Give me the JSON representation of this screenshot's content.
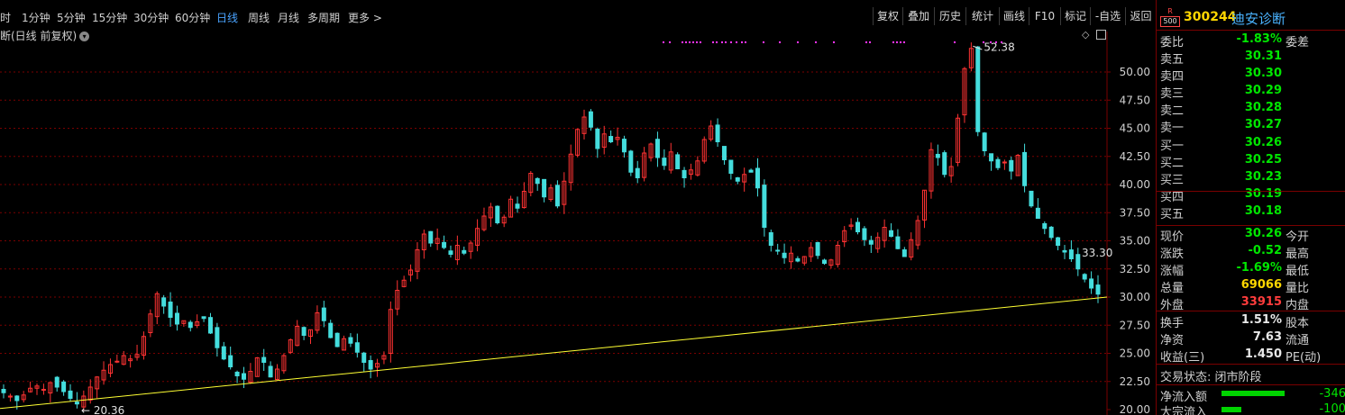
{
  "toolbar": {
    "periods": [
      "时",
      "1分钟",
      "5分钟",
      "15分钟",
      "30分钟",
      "60分钟",
      "日线",
      "周线",
      "月线",
      "多周期",
      "更多 >"
    ],
    "active_period": "日线",
    "buttons": [
      "复权",
      "叠加",
      "历史",
      "统计",
      "画线",
      "F10",
      "标记",
      "-自选",
      "返回"
    ]
  },
  "chart_title": "断(日线 前复权)",
  "stock": {
    "badge_top": "R",
    "badge_bottom": "500",
    "code": "300244",
    "name": "迪安诊断"
  },
  "quote_rows": [
    {
      "label": "委比",
      "value": "-1.83%",
      "label2": "委差",
      "color": "green"
    },
    {
      "label": "卖五",
      "value": "30.31",
      "label2": "",
      "color": "green"
    },
    {
      "label": "卖四",
      "value": "30.30",
      "label2": "",
      "color": "green"
    },
    {
      "label": "卖三",
      "value": "30.29",
      "label2": "",
      "color": "green"
    },
    {
      "label": "卖二",
      "value": "30.28",
      "label2": "",
      "color": "green"
    },
    {
      "label": "卖一",
      "value": "30.27",
      "label2": "",
      "color": "green"
    },
    {
      "label": "买一",
      "value": "30.26",
      "label2": "",
      "color": "green"
    },
    {
      "label": "买二",
      "value": "30.25",
      "label2": "",
      "color": "green"
    },
    {
      "label": "买三",
      "value": "30.23",
      "label2": "",
      "color": "green"
    },
    {
      "label": "买四",
      "value": "30.19",
      "label2": "",
      "color": "green"
    },
    {
      "label": "买五",
      "value": "30.18",
      "label2": "",
      "color": "green"
    },
    {
      "label": "现价",
      "value": "30.26",
      "label2": "今开",
      "color": "green"
    },
    {
      "label": "涨跌",
      "value": "-0.52",
      "label2": "最高",
      "color": "green"
    },
    {
      "label": "涨幅",
      "value": "-1.69%",
      "label2": "最低",
      "color": "green"
    },
    {
      "label": "总量",
      "value": "69066",
      "label2": "量比",
      "color": "yellow"
    },
    {
      "label": "外盘",
      "value": "33915",
      "label2": "内盘",
      "color": "red"
    },
    {
      "label": "换手",
      "value": "1.51%",
      "label2": "股本",
      "color": "white"
    },
    {
      "label": "净资",
      "value": "7.63",
      "label2": "流通",
      "color": "white"
    },
    {
      "label": "收益(三)",
      "value": "1.450",
      "label2": "PE(动)",
      "color": "white"
    }
  ],
  "trade_status": "交易状态: 闭市阶段",
  "flows": [
    {
      "label": "净流入额",
      "value": "-346"
    },
    {
      "label": "大宗流入",
      "value": "-100"
    }
  ],
  "colors": {
    "up": "#ff3333",
    "down": "#44dddd",
    "grid": "#7a0000",
    "trend": "#ffff33",
    "text": "#d0d0d0",
    "dots": "#ff33ff"
  },
  "chart_data": {
    "type": "candlestick",
    "y_ticks": [
      "20.00",
      "22.50",
      "25.00",
      "27.50",
      "30.00",
      "32.50",
      "35.00",
      "37.50",
      "40.00",
      "42.50",
      "45.00",
      "47.50",
      "50.00"
    ],
    "ylim": [
      20,
      53.5
    ],
    "annotations": {
      "high": "52.38",
      "low": "20.36",
      "last": "33.30"
    },
    "trendline": {
      "start": 20.1,
      "end": 30.0
    },
    "close_path": [
      21.5,
      21.2,
      20.8,
      21.3,
      21.9,
      22.1,
      21.8,
      22.4,
      22.0,
      21.6,
      21.0,
      20.5,
      21.2,
      22.0,
      22.9,
      23.5,
      24.0,
      24.3,
      24.8,
      24.5,
      24.9,
      26.5,
      28.5,
      30.3,
      29.2,
      28.2,
      27.6,
      27.9,
      27.3,
      27.8,
      28.1,
      26.8,
      25.5,
      24.5,
      23.8,
      23.0,
      22.7,
      23.4,
      24.6,
      24.2,
      22.9,
      23.6,
      24.8,
      26.2,
      27.4,
      26.6,
      27.1,
      28.6,
      27.9,
      26.4,
      25.6,
      26.3,
      25.9,
      25.1,
      24.2,
      23.6,
      24.1,
      24.8,
      28.9,
      30.6,
      31.5,
      32.4,
      34.2,
      35.6,
      34.8,
      35.2,
      34.4,
      33.8,
      34.6,
      33.9,
      34.8,
      36.1,
      37.2,
      38.0,
      36.6,
      37.1,
      38.7,
      37.9,
      39.4,
      41.0,
      40.1,
      38.9,
      39.7,
      38.1,
      40.3,
      42.7,
      44.9,
      46.0,
      45.1,
      43.2,
      44.5,
      43.8,
      44.2,
      42.9,
      41.1,
      40.6,
      42.8,
      43.6,
      42.4,
      41.7,
      42.9,
      41.4,
      40.6,
      41.3,
      42.1,
      44.0,
      45.2,
      43.8,
      42.2,
      41.0,
      40.3,
      40.9,
      41.1,
      39.7,
      36.2,
      34.6,
      34.1,
      33.5,
      33.9,
      33.2,
      33.6,
      34.4,
      33.7,
      33.0,
      33.3,
      34.6,
      35.9,
      36.4,
      35.8,
      35.1,
      34.7,
      35.3,
      36.2,
      35.4,
      34.3,
      33.6,
      35.1,
      36.8,
      39.5,
      43.1,
      42.4,
      40.9,
      41.6,
      45.9,
      50.3,
      52.1,
      44.7,
      43.0,
      42.1,
      41.5,
      42.0,
      41.2,
      42.6,
      39.9,
      38.1,
      37.0,
      36.1,
      35.3,
      34.6,
      34.0,
      33.4,
      32.5,
      31.6,
      30.8,
      30.26
    ]
  }
}
